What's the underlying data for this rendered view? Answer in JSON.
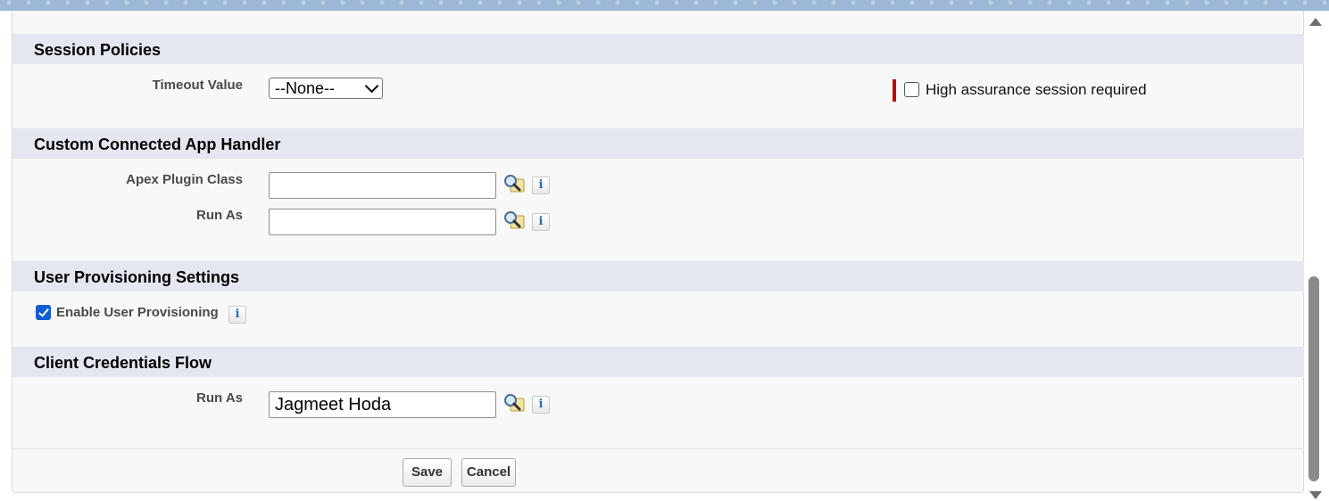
{
  "sections": {
    "session_policies": {
      "title": "Session Policies",
      "timeout_label": "Timeout Value",
      "timeout_value": "--None--",
      "high_assurance_label": "High assurance session required",
      "high_assurance_checked": false
    },
    "custom_handler": {
      "title": "Custom Connected App Handler",
      "apex_label": "Apex Plugin Class",
      "apex_value": "",
      "run_as_label": "Run As",
      "run_as_value": ""
    },
    "user_provisioning": {
      "title": "User Provisioning Settings",
      "enable_label": "Enable User Provisioning",
      "enable_checked": true
    },
    "client_credentials": {
      "title": "Client Credentials Flow",
      "run_as_label": "Run As",
      "run_as_value": "Jagmeet Hoda"
    }
  },
  "footer": {
    "save_label": "Save",
    "cancel_label": "Cancel"
  },
  "icons": {
    "lookup": "lookup-magnifier-icon",
    "info": "info-icon",
    "info_glyph": "i"
  },
  "colors": {
    "section_header_bg": "#e4e7ef",
    "required_bar": "#c00000",
    "checkbox_checked": "#0b5cd5",
    "info_glyph": "#2a6bb5"
  }
}
